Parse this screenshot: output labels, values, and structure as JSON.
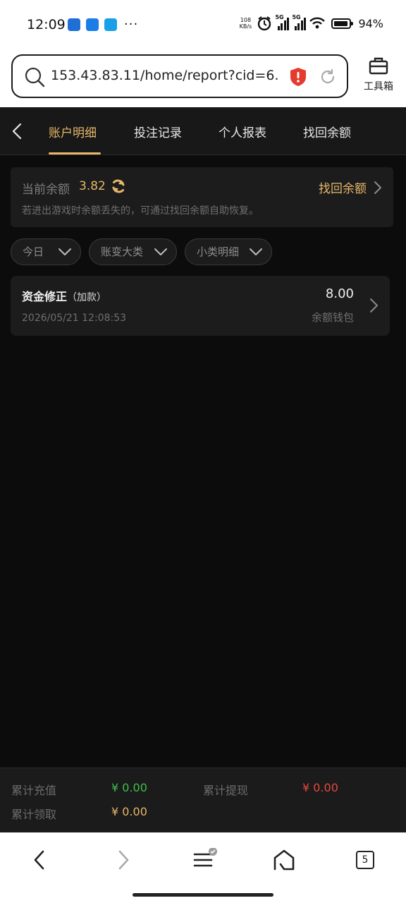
{
  "status_bar": {
    "time": "12:09",
    "net_speed_value": "108",
    "net_speed_unit": "KB/s",
    "signal1_label": "5G",
    "signal2_label": "5G",
    "battery_level": 0.94,
    "battery_pct": "94%",
    "more_dots": "···"
  },
  "browser": {
    "url": "153.43.83.11/home/report?cid=6...",
    "toolbox_label": "工具箱",
    "tab_count": "5"
  },
  "nav": {
    "tabs": [
      {
        "label": "账户明细",
        "active": true
      },
      {
        "label": "投注记录",
        "active": false
      },
      {
        "label": "个人报表",
        "active": false
      },
      {
        "label": "找回余额",
        "active": false
      }
    ]
  },
  "balance": {
    "label": "当前余额",
    "value": "3.82",
    "recover_link": "找回余额",
    "hint": "若进出游戏时余额丢失的，可通过找回余额自助恢复。"
  },
  "filters": [
    {
      "label": "今日"
    },
    {
      "label": "账变大类"
    },
    {
      "label": "小类明细"
    }
  ],
  "records": [
    {
      "title": "资金修正",
      "subtitle": "（加款）",
      "time": "2026/05/21 12:08:53",
      "amount": "8.00",
      "wallet": "余额钱包"
    }
  ],
  "summary": {
    "total_deposit_label": "累计充值",
    "total_deposit_value": "¥ 0.00",
    "total_withdraw_label": "累计提现",
    "total_withdraw_value": "¥ 0.00",
    "total_claim_label": "累计领取",
    "total_claim_value": "¥ 0.00"
  },
  "colors": {
    "accent": "#e6b86a",
    "deposit_green": "#3fbf4a",
    "withdraw_red": "#e5483c",
    "claim_gold": "#e6b86a",
    "background": "#0c0c0c",
    "card": "#1c1c1c"
  },
  "icons": {
    "search": "search-icon",
    "shield": "shield-alert-icon",
    "reload": "reload-icon",
    "toolbox": "toolbox-icon",
    "back": "chevron-left-icon",
    "refresh": "refresh-icon",
    "dropdown": "chevron-down-icon",
    "row_chevron": "chevron-right-icon"
  }
}
